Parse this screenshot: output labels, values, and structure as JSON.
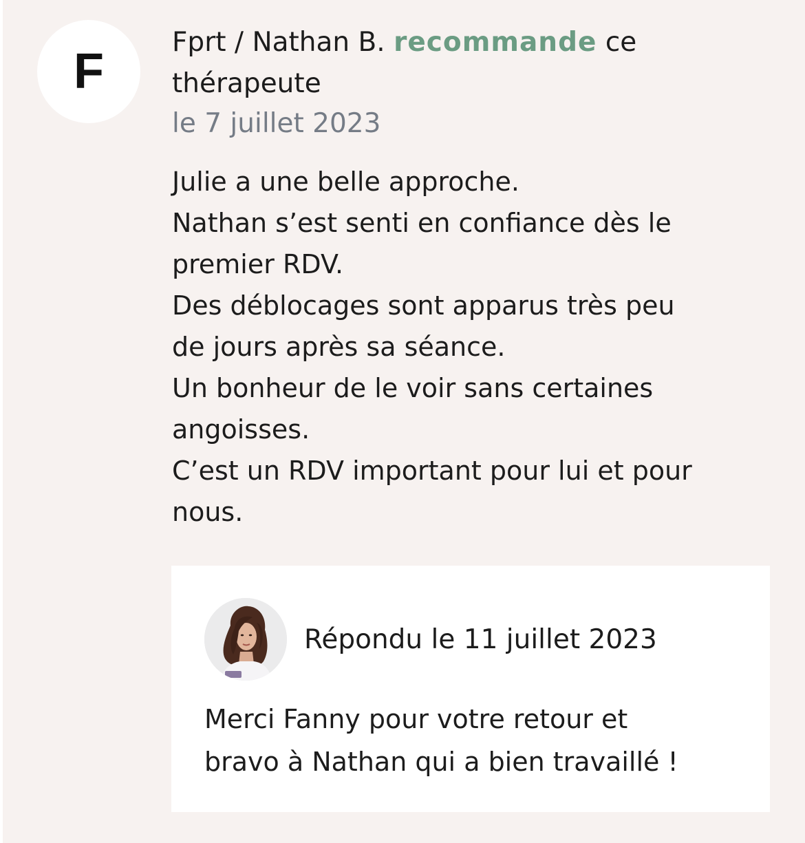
{
  "review": {
    "avatar_letter": "F",
    "author": "Fprt / Nathan B.",
    "action": "recommande",
    "action_color": "#6b9c83",
    "suffix_line1": "ce",
    "suffix_line2": "thérapeute",
    "date": "le 7 juillet 2023",
    "lines": [
      "Julie a une belle approche.",
      "Nathan s’est senti en confiance dès le",
      "premier RDV.",
      "Des déblocages sont apparus très peu",
      "de jours après sa séance.",
      "Un bonheur de le voir sans certaines",
      "angoisses.",
      "C’est un RDV important pour lui et pour",
      "nous."
    ]
  },
  "reply": {
    "date": "Répondu le 11 juillet 2023",
    "lines": [
      "Merci Fanny pour votre retour et",
      "bravo à Nathan qui a bien travaillé !"
    ]
  }
}
